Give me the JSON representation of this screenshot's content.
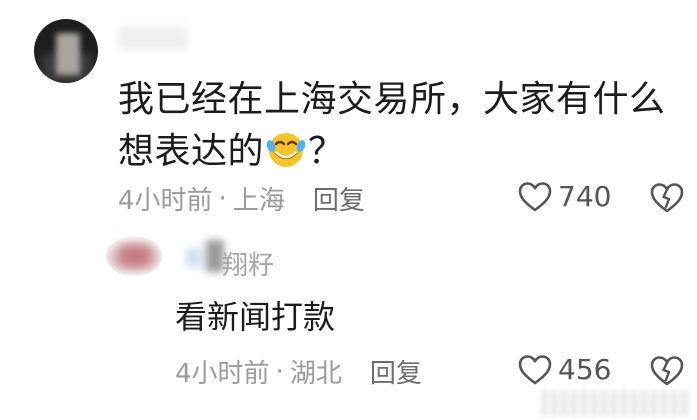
{
  "comment": {
    "text_part1": "我已经在上海交易所，大家有什么想表达的",
    "text_part2": "？",
    "emoji": "laughing-face-emoji",
    "time": "4小时前",
    "separator": "·",
    "location": "上海",
    "reply_label": "回复",
    "likes": "740"
  },
  "reply": {
    "author": "翔籽",
    "text": "看新闻打款",
    "time": "4小时前",
    "separator": "·",
    "location": "湖北",
    "reply_label": "回复",
    "likes": "456"
  },
  "colors": {
    "text_primary": "#1c1c1c",
    "text_meta": "#9b9b9b",
    "icon": "#555555"
  }
}
